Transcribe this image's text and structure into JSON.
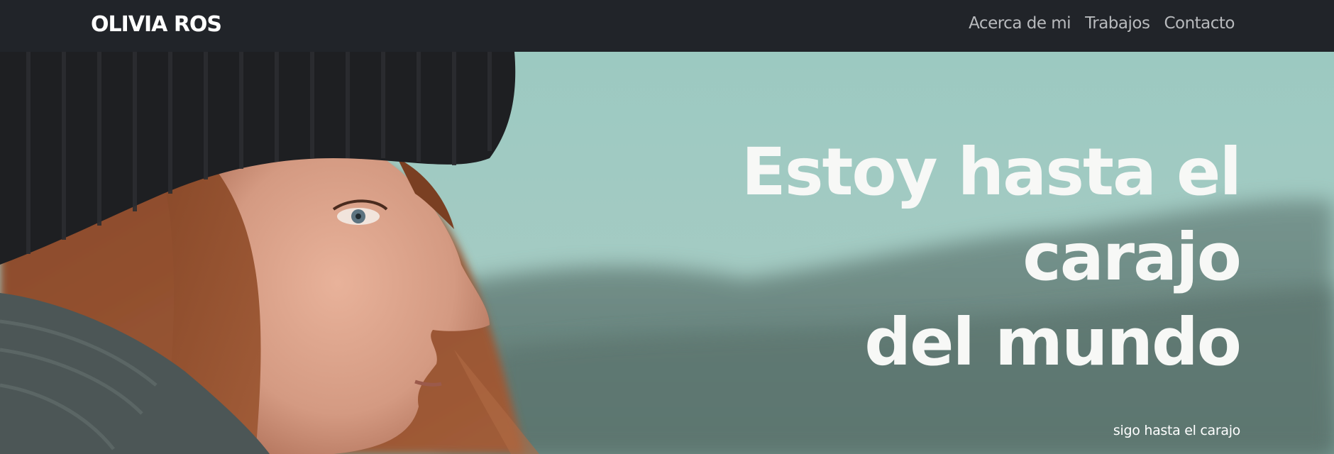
{
  "header": {
    "brand": "OLIVIA ROS",
    "nav": [
      {
        "label": "Acerca de mi"
      },
      {
        "label": "Trabajos"
      },
      {
        "label": "Contacto"
      }
    ]
  },
  "hero": {
    "headline_lines": [
      "Estoy hasta el",
      "carajo",
      "del mundo"
    ],
    "subline": "sigo hasta el carajo",
    "image": "woman-profile-photo"
  },
  "colors": {
    "navbar_bg": "#212429",
    "nav_text": "#b8babd",
    "hero_text": "#f7f8f6"
  }
}
